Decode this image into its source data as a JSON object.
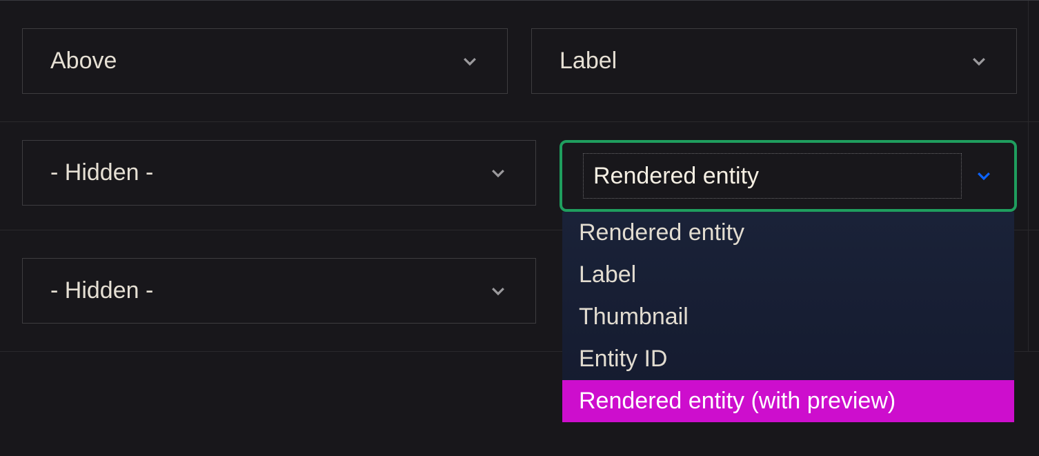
{
  "rows": [
    {
      "left": {
        "value": "Above"
      },
      "right": {
        "value": "Label"
      }
    },
    {
      "left": {
        "value": "- Hidden -"
      },
      "dropdown": {
        "current": "Rendered entity",
        "options": [
          "Rendered entity",
          "Label",
          "Thumbnail",
          "Entity ID",
          "Rendered entity (with preview)"
        ],
        "highlight_index": 4
      }
    },
    {
      "left": {
        "value": "- Hidden -"
      }
    }
  ]
}
